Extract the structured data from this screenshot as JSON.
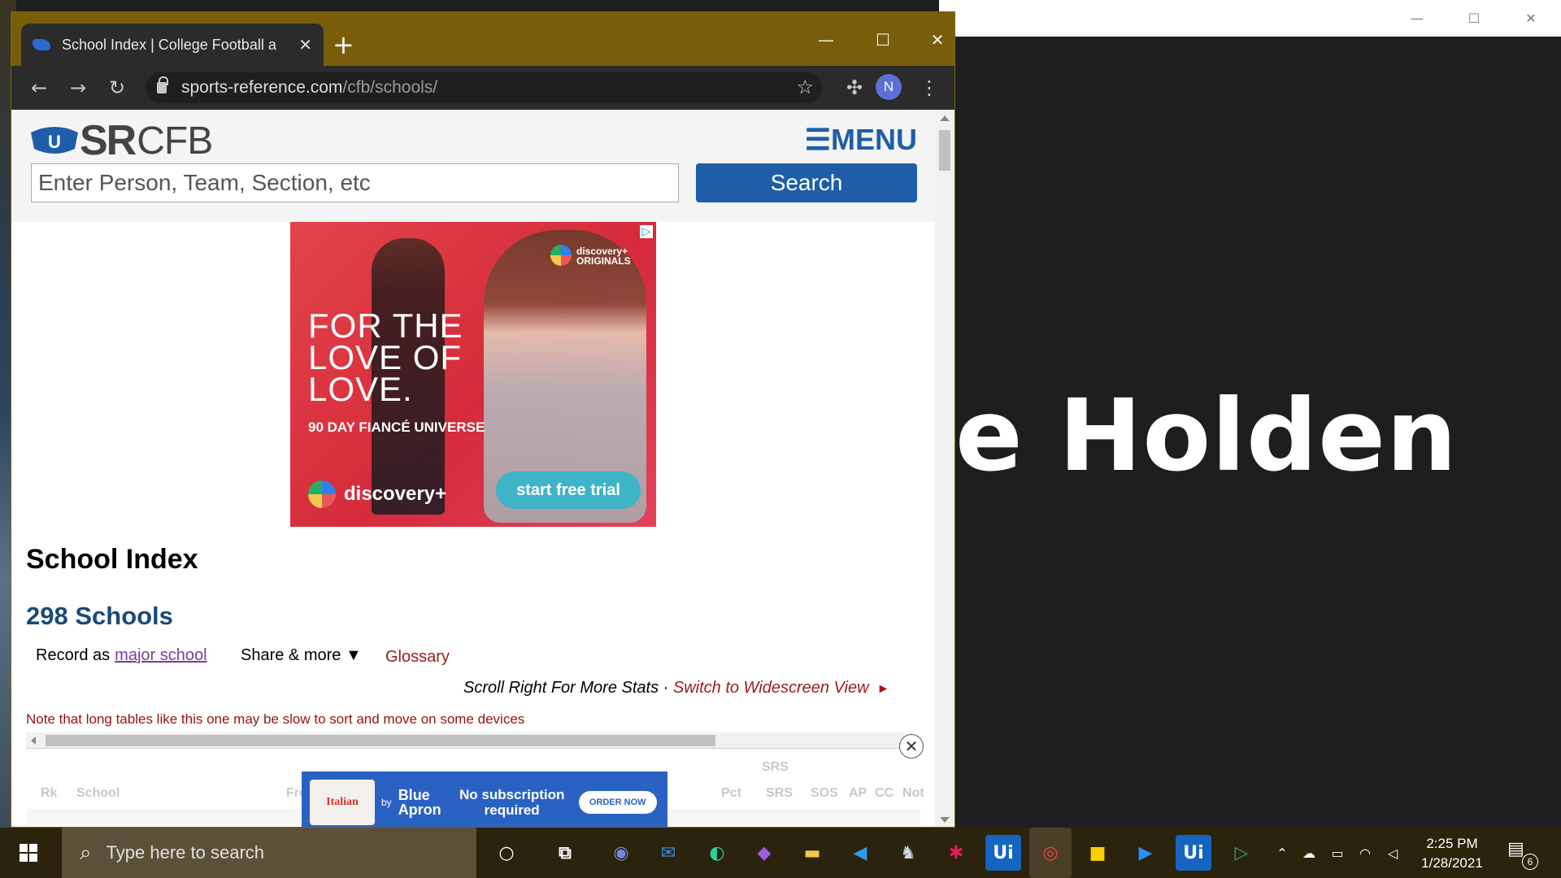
{
  "browser": {
    "tab_title": "School Index | College Football a",
    "tab_close": "✕",
    "new_tab": "+",
    "url_domain": "sports-reference.com",
    "url_path": "/cfb/schools/",
    "avatar_initial": "N",
    "accent_color": "#7a5d0a"
  },
  "site": {
    "logo_sr": "SR",
    "logo_cfb": "CFB",
    "menu_label": "☰MENU",
    "search_placeholder": "Enter Person, Team, Section, etc",
    "search_button": "Search",
    "brand_color": "#1e5ea8"
  },
  "ad_top": {
    "headline_1": "FOR THE",
    "headline_2": "LOVE OF",
    "headline_3": "LOVE.",
    "subline": "90 DAY FIANCÉ UNIVERSE",
    "brand": "discovery+",
    "cta": "start free trial",
    "badge_1": "discovery+",
    "badge_2": "ORIGINALS"
  },
  "content": {
    "title": "School Index",
    "count_heading": "298 Schools",
    "record_as_label": "Record as",
    "record_as_link": "major school",
    "share_label": "Share & more ▼",
    "glossary": "Glossary",
    "scroll_hint": "Scroll Right For More Stats",
    "separator": " · ",
    "widescreen": "Switch to Widescreen View",
    "widescreen_arrow": "►",
    "note": "Note that long tables like this one may be slow to sort and move on some devices"
  },
  "table": {
    "group_header": "SRS",
    "columns": [
      "Rk",
      "School",
      "Fro",
      "Pct",
      "SRS",
      "SOS",
      "AP",
      "CC",
      "Not"
    ]
  },
  "ad_bottom": {
    "brand_left": "Italian",
    "by": "by",
    "brand_right": "Blue Apron",
    "message": "No subscription required",
    "cta": "ORDER NOW"
  },
  "background_window": {
    "big_text": "e Holden"
  },
  "taskbar": {
    "search_placeholder": "Type here to search",
    "time": "2:25 PM",
    "date": "1/28/2021",
    "notification_count": "6",
    "apps": [
      "cortana",
      "task-view",
      "discord",
      "mail",
      "edge",
      "visual-studio",
      "file-explorer",
      "vscode",
      "postgres",
      "slack",
      "uipath",
      "chrome",
      "sticky-notes",
      "zoom",
      "uipath-studio",
      "media-player"
    ]
  }
}
